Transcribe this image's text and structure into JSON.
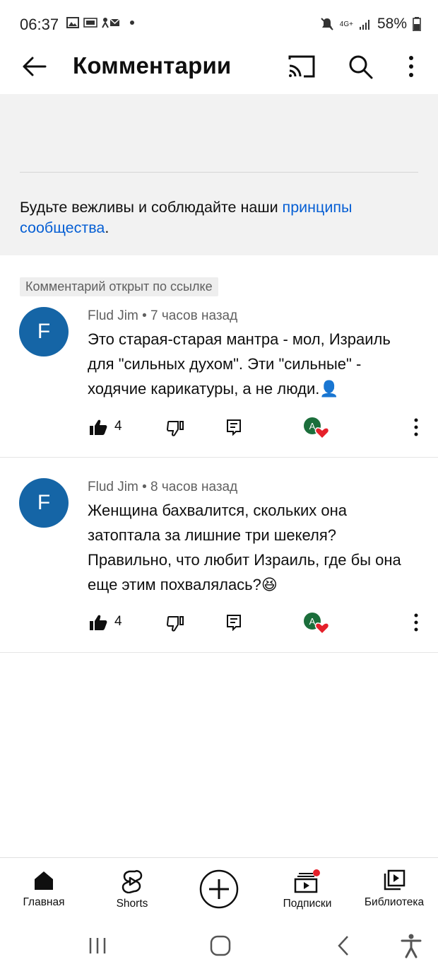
{
  "status_bar": {
    "time": "06:37",
    "battery": "58%",
    "network": "4G+"
  },
  "app_bar": {
    "title": "Комментарии"
  },
  "guidelines": {
    "text_before": "Будьте вежливы и соблюдайте наши ",
    "link_text": "принципы сообщества",
    "text_after": "."
  },
  "highlight_chip": "Комментарий открыт по ссылке",
  "comments": [
    {
      "avatar_letter": "F",
      "author": "Flud Jim",
      "time": "7 часов назад",
      "text": "Это старая-старая мантра - мол, Израиль для \"сильных духом\". Эти \"сильные\" - ходячие карикатуры, а не люди.",
      "emoji": "👤",
      "likes": "4",
      "hearted_by_letter": "A"
    },
    {
      "avatar_letter": "F",
      "author": "Flud Jim",
      "time": "8 часов назад",
      "text": "Женщина бахвалится, скольких она затоптала за лишние три шекеля? Правильно, что любит Израиль, где бы она еще этим похвалялась?",
      "emoji": "😆",
      "likes": "4",
      "hearted_by_letter": "A"
    }
  ],
  "bottom_nav": {
    "home": "Главная",
    "shorts": "Shorts",
    "subscriptions": "Подписки",
    "library": "Библиотека"
  },
  "colors": {
    "avatar": "#1565a6",
    "link": "#065fd4",
    "heart": "#e5202a",
    "hearted_avatar": "#1b6e3b",
    "notification_dot": "#e5202a"
  }
}
